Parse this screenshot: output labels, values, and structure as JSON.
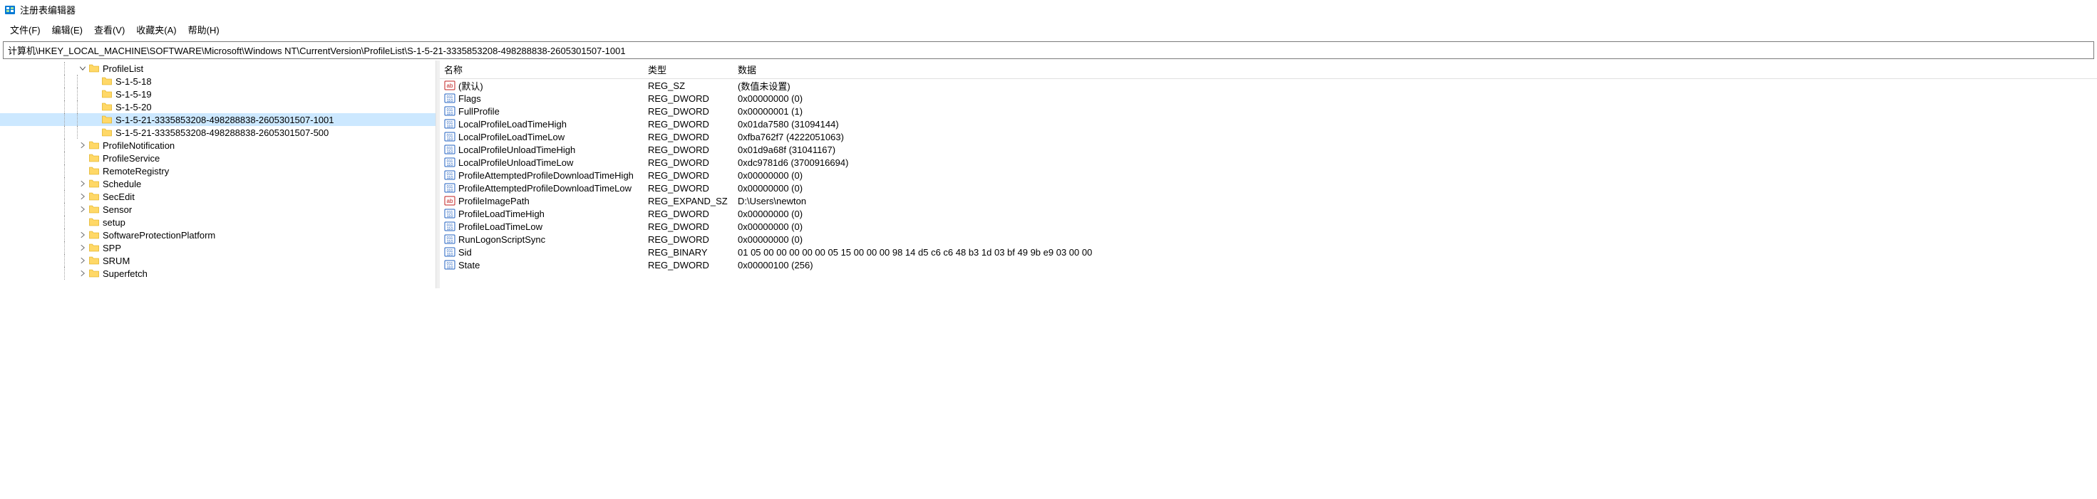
{
  "titlebar": {
    "text": "注册表编辑器"
  },
  "menu": {
    "file": "文件(F)",
    "edit": "编辑(E)",
    "view": "查看(V)",
    "favorites": "收藏夹(A)",
    "help": "帮助(H)"
  },
  "address": "计算机\\HKEY_LOCAL_MACHINE\\SOFTWARE\\Microsoft\\Windows NT\\CurrentVersion\\ProfileList\\S-1-5-21-3335853208-498288838-2605301507-1001",
  "tree": [
    {
      "depth": 6,
      "expander": "open",
      "label": "ProfileList"
    },
    {
      "depth": 7,
      "expander": "none",
      "label": "S-1-5-18"
    },
    {
      "depth": 7,
      "expander": "none",
      "label": "S-1-5-19"
    },
    {
      "depth": 7,
      "expander": "none",
      "label": "S-1-5-20"
    },
    {
      "depth": 7,
      "expander": "none",
      "label": "S-1-5-21-3335853208-498288838-2605301507-1001",
      "selected": true
    },
    {
      "depth": 7,
      "expander": "none",
      "label": "S-1-5-21-3335853208-498288838-2605301507-500"
    },
    {
      "depth": 6,
      "expander": "closed",
      "label": "ProfileNotification"
    },
    {
      "depth": 6,
      "expander": "none",
      "label": "ProfileService"
    },
    {
      "depth": 6,
      "expander": "none",
      "label": "RemoteRegistry"
    },
    {
      "depth": 6,
      "expander": "closed",
      "label": "Schedule"
    },
    {
      "depth": 6,
      "expander": "closed",
      "label": "SecEdit"
    },
    {
      "depth": 6,
      "expander": "closed",
      "label": "Sensor"
    },
    {
      "depth": 6,
      "expander": "none",
      "label": "setup"
    },
    {
      "depth": 6,
      "expander": "closed",
      "label": "SoftwareProtectionPlatform"
    },
    {
      "depth": 6,
      "expander": "closed",
      "label": "SPP"
    },
    {
      "depth": 6,
      "expander": "closed",
      "label": "SRUM"
    },
    {
      "depth": 6,
      "expander": "closed",
      "label": "Superfetch"
    }
  ],
  "valuesHeader": {
    "name": "名称",
    "type": "类型",
    "data": "数据"
  },
  "values": [
    {
      "icon": "str",
      "name": "(默认)",
      "type": "REG_SZ",
      "data": "(数值未设置)"
    },
    {
      "icon": "bin",
      "name": "Flags",
      "type": "REG_DWORD",
      "data": "0x00000000 (0)"
    },
    {
      "icon": "bin",
      "name": "FullProfile",
      "type": "REG_DWORD",
      "data": "0x00000001 (1)"
    },
    {
      "icon": "bin",
      "name": "LocalProfileLoadTimeHigh",
      "type": "REG_DWORD",
      "data": "0x01da7580 (31094144)"
    },
    {
      "icon": "bin",
      "name": "LocalProfileLoadTimeLow",
      "type": "REG_DWORD",
      "data": "0xfba762f7 (4222051063)"
    },
    {
      "icon": "bin",
      "name": "LocalProfileUnloadTimeHigh",
      "type": "REG_DWORD",
      "data": "0x01d9a68f (31041167)"
    },
    {
      "icon": "bin",
      "name": "LocalProfileUnloadTimeLow",
      "type": "REG_DWORD",
      "data": "0xdc9781d6 (3700916694)"
    },
    {
      "icon": "bin",
      "name": "ProfileAttemptedProfileDownloadTimeHigh",
      "type": "REG_DWORD",
      "data": "0x00000000 (0)"
    },
    {
      "icon": "bin",
      "name": "ProfileAttemptedProfileDownloadTimeLow",
      "type": "REG_DWORD",
      "data": "0x00000000 (0)"
    },
    {
      "icon": "str",
      "name": "ProfileImagePath",
      "type": "REG_EXPAND_SZ",
      "data": "D:\\Users\\newton"
    },
    {
      "icon": "bin",
      "name": "ProfileLoadTimeHigh",
      "type": "REG_DWORD",
      "data": "0x00000000 (0)"
    },
    {
      "icon": "bin",
      "name": "ProfileLoadTimeLow",
      "type": "REG_DWORD",
      "data": "0x00000000 (0)"
    },
    {
      "icon": "bin",
      "name": "RunLogonScriptSync",
      "type": "REG_DWORD",
      "data": "0x00000000 (0)"
    },
    {
      "icon": "bin",
      "name": "Sid",
      "type": "REG_BINARY",
      "data": "01 05 00 00 00 00 00 05 15 00 00 00 98 14 d5 c6 c6 48 b3 1d 03 bf 49 9b e9 03 00 00"
    },
    {
      "icon": "bin",
      "name": "State",
      "type": "REG_DWORD",
      "data": "0x00000100 (256)"
    }
  ]
}
